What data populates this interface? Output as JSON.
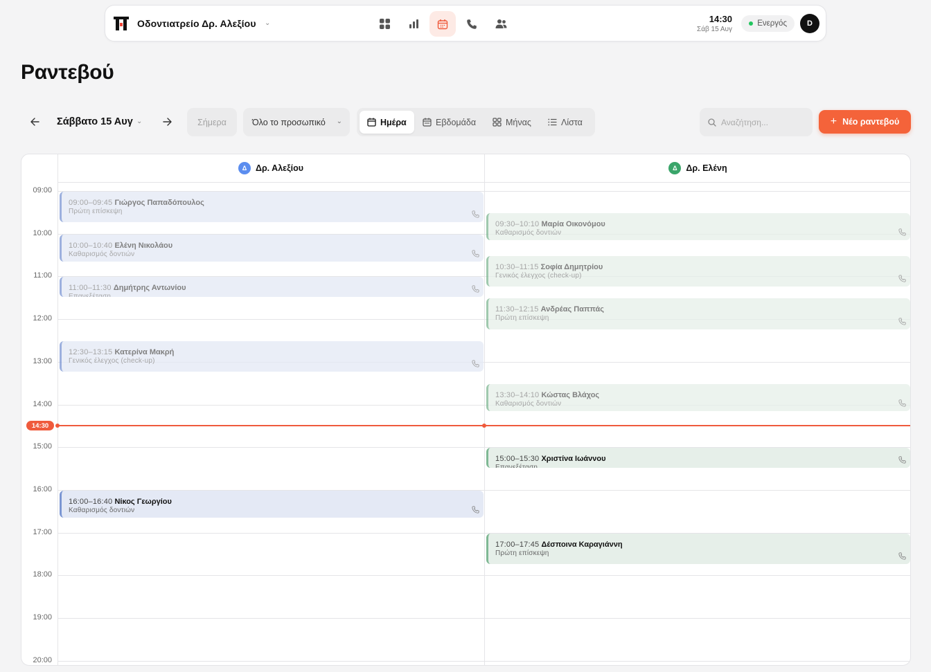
{
  "header": {
    "clinic_name": "Οδοντιατρείο Δρ. Αλεξίου",
    "nav": [
      {
        "icon": "grid-icon"
      },
      {
        "icon": "bar-chart-icon"
      },
      {
        "icon": "calendar-icon",
        "active": true
      },
      {
        "icon": "phone-icon"
      },
      {
        "icon": "users-icon"
      }
    ],
    "time": "14:30",
    "date": "Σάβ 15 Αυγ",
    "status": "Ενεργός",
    "avatar_initial": "D"
  },
  "page_title": "Ραντεβού",
  "toolbar": {
    "date_label": "Σάββατο 15 Αυγ",
    "today_label": "Σήμερα",
    "staff_filter": "Όλο το προσωπικό",
    "views": [
      "Ημέρα",
      "Εβδομάδα",
      "Μήνας",
      "Λίστα"
    ],
    "active_view": "Ημέρα",
    "search_placeholder": "Αναζήτηση...",
    "new_button": "Νέο ραντεβού"
  },
  "calendar": {
    "columns": [
      {
        "name": "Δρ. Αλεξίου",
        "initial": "Δ",
        "color": "#5b8def"
      },
      {
        "name": "Δρ. Ελένη",
        "initial": "Δ",
        "color": "#3aa56a"
      }
    ],
    "hours": [
      "09:00",
      "10:00",
      "11:00",
      "12:00",
      "13:00",
      "14:00",
      "15:00",
      "16:00",
      "17:00",
      "18:00",
      "19:00",
      "20:00"
    ],
    "now_label": "14:30",
    "now_color": "#ef5a3c",
    "appointments": [
      {
        "col": 0,
        "time": "09:00–09:45",
        "name": "Γιώργος Παπαδόπουλος",
        "service": "Πρώτη επίσκεψη",
        "past": true
      },
      {
        "col": 0,
        "time": "10:00–10:40",
        "name": "Ελένη Νικολάου",
        "service": "Καθαρισμός δοντιών",
        "past": true
      },
      {
        "col": 0,
        "time": "11:00–11:30",
        "name": "Δημήτρης Αντωνίου",
        "service": "Επανεξέταση",
        "past": true
      },
      {
        "col": 0,
        "time": "12:30–13:15",
        "name": "Κατερίνα Μακρή",
        "service": "Γενικός έλεγχος (check-up)",
        "past": true
      },
      {
        "col": 0,
        "time": "16:00–16:40",
        "name": "Νίκος Γεωργίου",
        "service": "Καθαρισμός δοντιών",
        "past": false
      },
      {
        "col": 1,
        "time": "09:30–10:10",
        "name": "Μαρία Οικονόμου",
        "service": "Καθαρισμός δοντιών",
        "past": true
      },
      {
        "col": 1,
        "time": "10:30–11:15",
        "name": "Σοφία Δημητρίου",
        "service": "Γενικός έλεγχος (check-up)",
        "past": true
      },
      {
        "col": 1,
        "time": "11:30–12:15",
        "name": "Ανδρέας Παππάς",
        "service": "Πρώτη επίσκεψη",
        "past": true
      },
      {
        "col": 1,
        "time": "13:30–14:10",
        "name": "Κώστας Βλάχος",
        "service": "Καθαρισμός δοντιών",
        "past": true
      },
      {
        "col": 1,
        "time": "15:00–15:30",
        "name": "Χριστίνα Ιωάννου",
        "service": "Επανεξέταση",
        "past": false
      },
      {
        "col": 1,
        "time": "17:00–17:45",
        "name": "Δέσποινα Καραγιάννη",
        "service": "Πρώτη επίσκεψη",
        "past": false
      }
    ]
  }
}
